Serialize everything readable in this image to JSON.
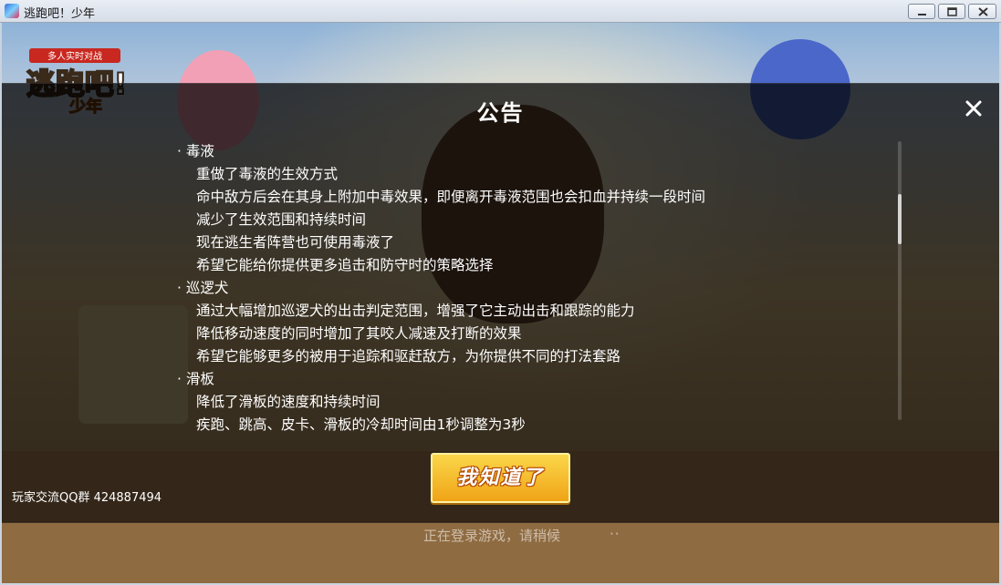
{
  "window": {
    "title": "逃跑吧！少年"
  },
  "logo": {
    "text": "逃跑吧！少年",
    "tagline": "多人实时对战"
  },
  "announcement": {
    "title": "公告",
    "lines": [
      {
        "kind": "section",
        "text": "· 毒液"
      },
      {
        "kind": "item",
        "text": "重做了毒液的生效方式"
      },
      {
        "kind": "item",
        "text": "命中敌方后会在其身上附加中毒效果，即便离开毒液范围也会扣血并持续一段时间"
      },
      {
        "kind": "item",
        "text": "减少了生效范围和持续时间"
      },
      {
        "kind": "item",
        "text": "现在逃生者阵营也可使用毒液了"
      },
      {
        "kind": "item",
        "text": "希望它能给你提供更多追击和防守时的策略选择"
      },
      {
        "kind": "section",
        "text": "· 巡逻犬"
      },
      {
        "kind": "item",
        "text": "通过大幅增加巡逻犬的出击判定范围，增强了它主动出击和跟踪的能力"
      },
      {
        "kind": "item",
        "text": "降低移动速度的同时增加了其咬人减速及打断的效果"
      },
      {
        "kind": "item",
        "text": "希望它能够更多的被用于追踪和驱赶敌方，为你提供不同的打法套路"
      },
      {
        "kind": "section",
        "text": "· 滑板"
      },
      {
        "kind": "item",
        "text": "降低了滑板的速度和持续时间"
      },
      {
        "kind": "item",
        "text": "疾跑、跳高、皮卡、滑板的冷却时间由1秒调整为3秒"
      }
    ],
    "confirm_label": "我知道了"
  },
  "footer": {
    "qq_group": "玩家交流QQ群 424887494",
    "status": "正在登录游戏，请稍候",
    "status_dots": "··"
  },
  "colors": {
    "overlay": "#000000",
    "button_top": "#fbd74a",
    "button_bottom": "#f0a417",
    "text": "#ffffff"
  }
}
